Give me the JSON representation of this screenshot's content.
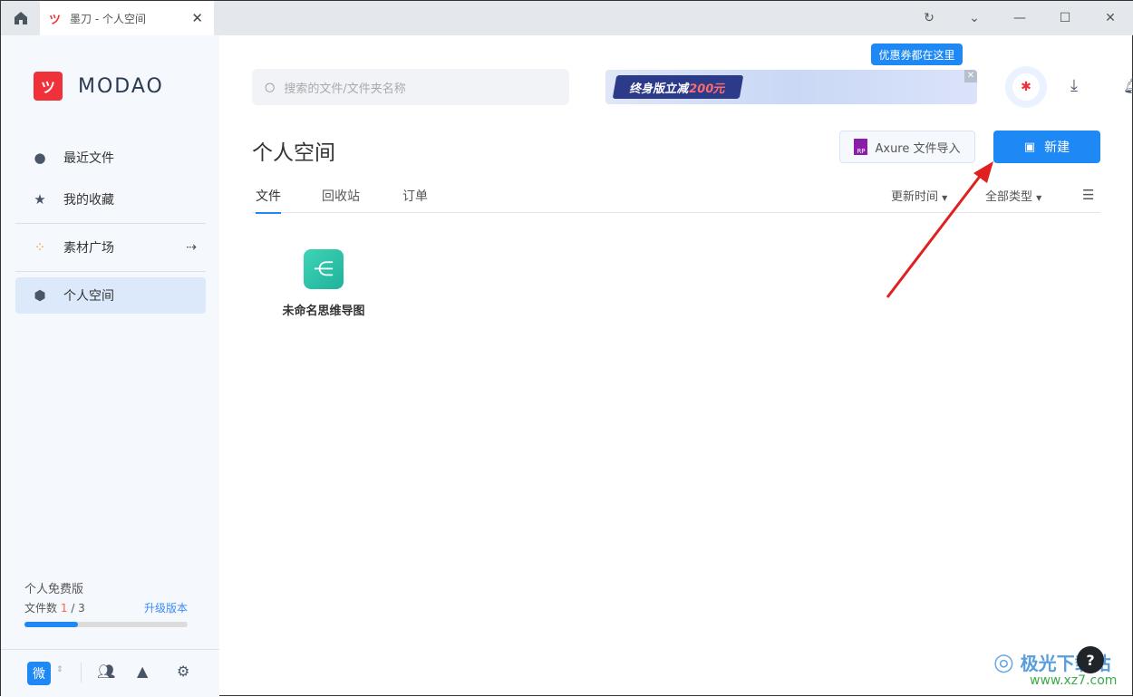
{
  "window": {
    "tab_title": "墨刀 - 个人空间",
    "tab_logo": "ꟷ"
  },
  "sidebar": {
    "brand": "MODAO",
    "items": [
      {
        "label": "最近文件",
        "icon": "clock-icon"
      },
      {
        "label": "我的收藏",
        "icon": "star-icon"
      },
      {
        "label": "素材广场",
        "icon": "apps-icon"
      },
      {
        "label": "个人空间",
        "icon": "cube-icon"
      }
    ],
    "plan": "个人免费版",
    "file_count_label": "文件数",
    "file_count_used": "1",
    "file_count_total": "/ 3",
    "file_progress": 0.33,
    "upgrade": "升级版本",
    "workspace_badge": "微"
  },
  "header": {
    "search_placeholder": "搜索的文件/文件夹名称",
    "banner_text": "终身版立减",
    "banner_amount": "200元",
    "tooltip": "优惠券都在这里"
  },
  "main": {
    "title": "个人空间",
    "axure_import": "Axure 文件导入",
    "new_button": "新建",
    "tabs": [
      "文件",
      "回收站",
      "订单"
    ],
    "sort": "更新时间",
    "type_filter": "全部类型",
    "files": [
      {
        "name": "未命名思维导图",
        "type": "mindmap"
      }
    ]
  },
  "watermark": {
    "name": "极光下载站",
    "url": "www.xz7.com"
  },
  "colors": {
    "accent": "#1e88f5",
    "brand": "#f0313a",
    "annotation_arrow": "#e02020"
  }
}
